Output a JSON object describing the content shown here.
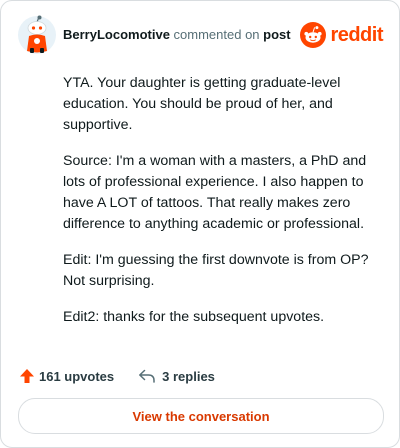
{
  "comment": {
    "author": "BerryLocomotive",
    "action_text": "commented on",
    "post_link": "post",
    "brand": "reddit",
    "paragraphs": [
      "YTA. Your daughter is getting graduate-level education. You should be proud of her, and supportive.",
      "Source: I'm a woman with a masters, a PhD and lots of professional experience. I also happen to have A LOT of tattoos. That really makes zero difference to anything academic or professional.",
      "Edit: I'm guessing the first downvote is from OP? Not surprising.",
      "Edit2: thanks for the subsequent upvotes."
    ]
  },
  "footer": {
    "upvotes_label": "161 upvotes",
    "replies_label": "3 replies",
    "cta_label": "View the conversation"
  },
  "colors": {
    "brand": "#ff4500",
    "cta_text": "#d93900",
    "text": "#0f1a1c",
    "muted": "#576f76",
    "border": "#d9dde0"
  },
  "icons": {
    "avatar": "snoo-avatar-icon",
    "logo": "reddit-logo-icon",
    "upvote": "upvote-arrow-icon",
    "reply": "reply-arrow-icon"
  }
}
